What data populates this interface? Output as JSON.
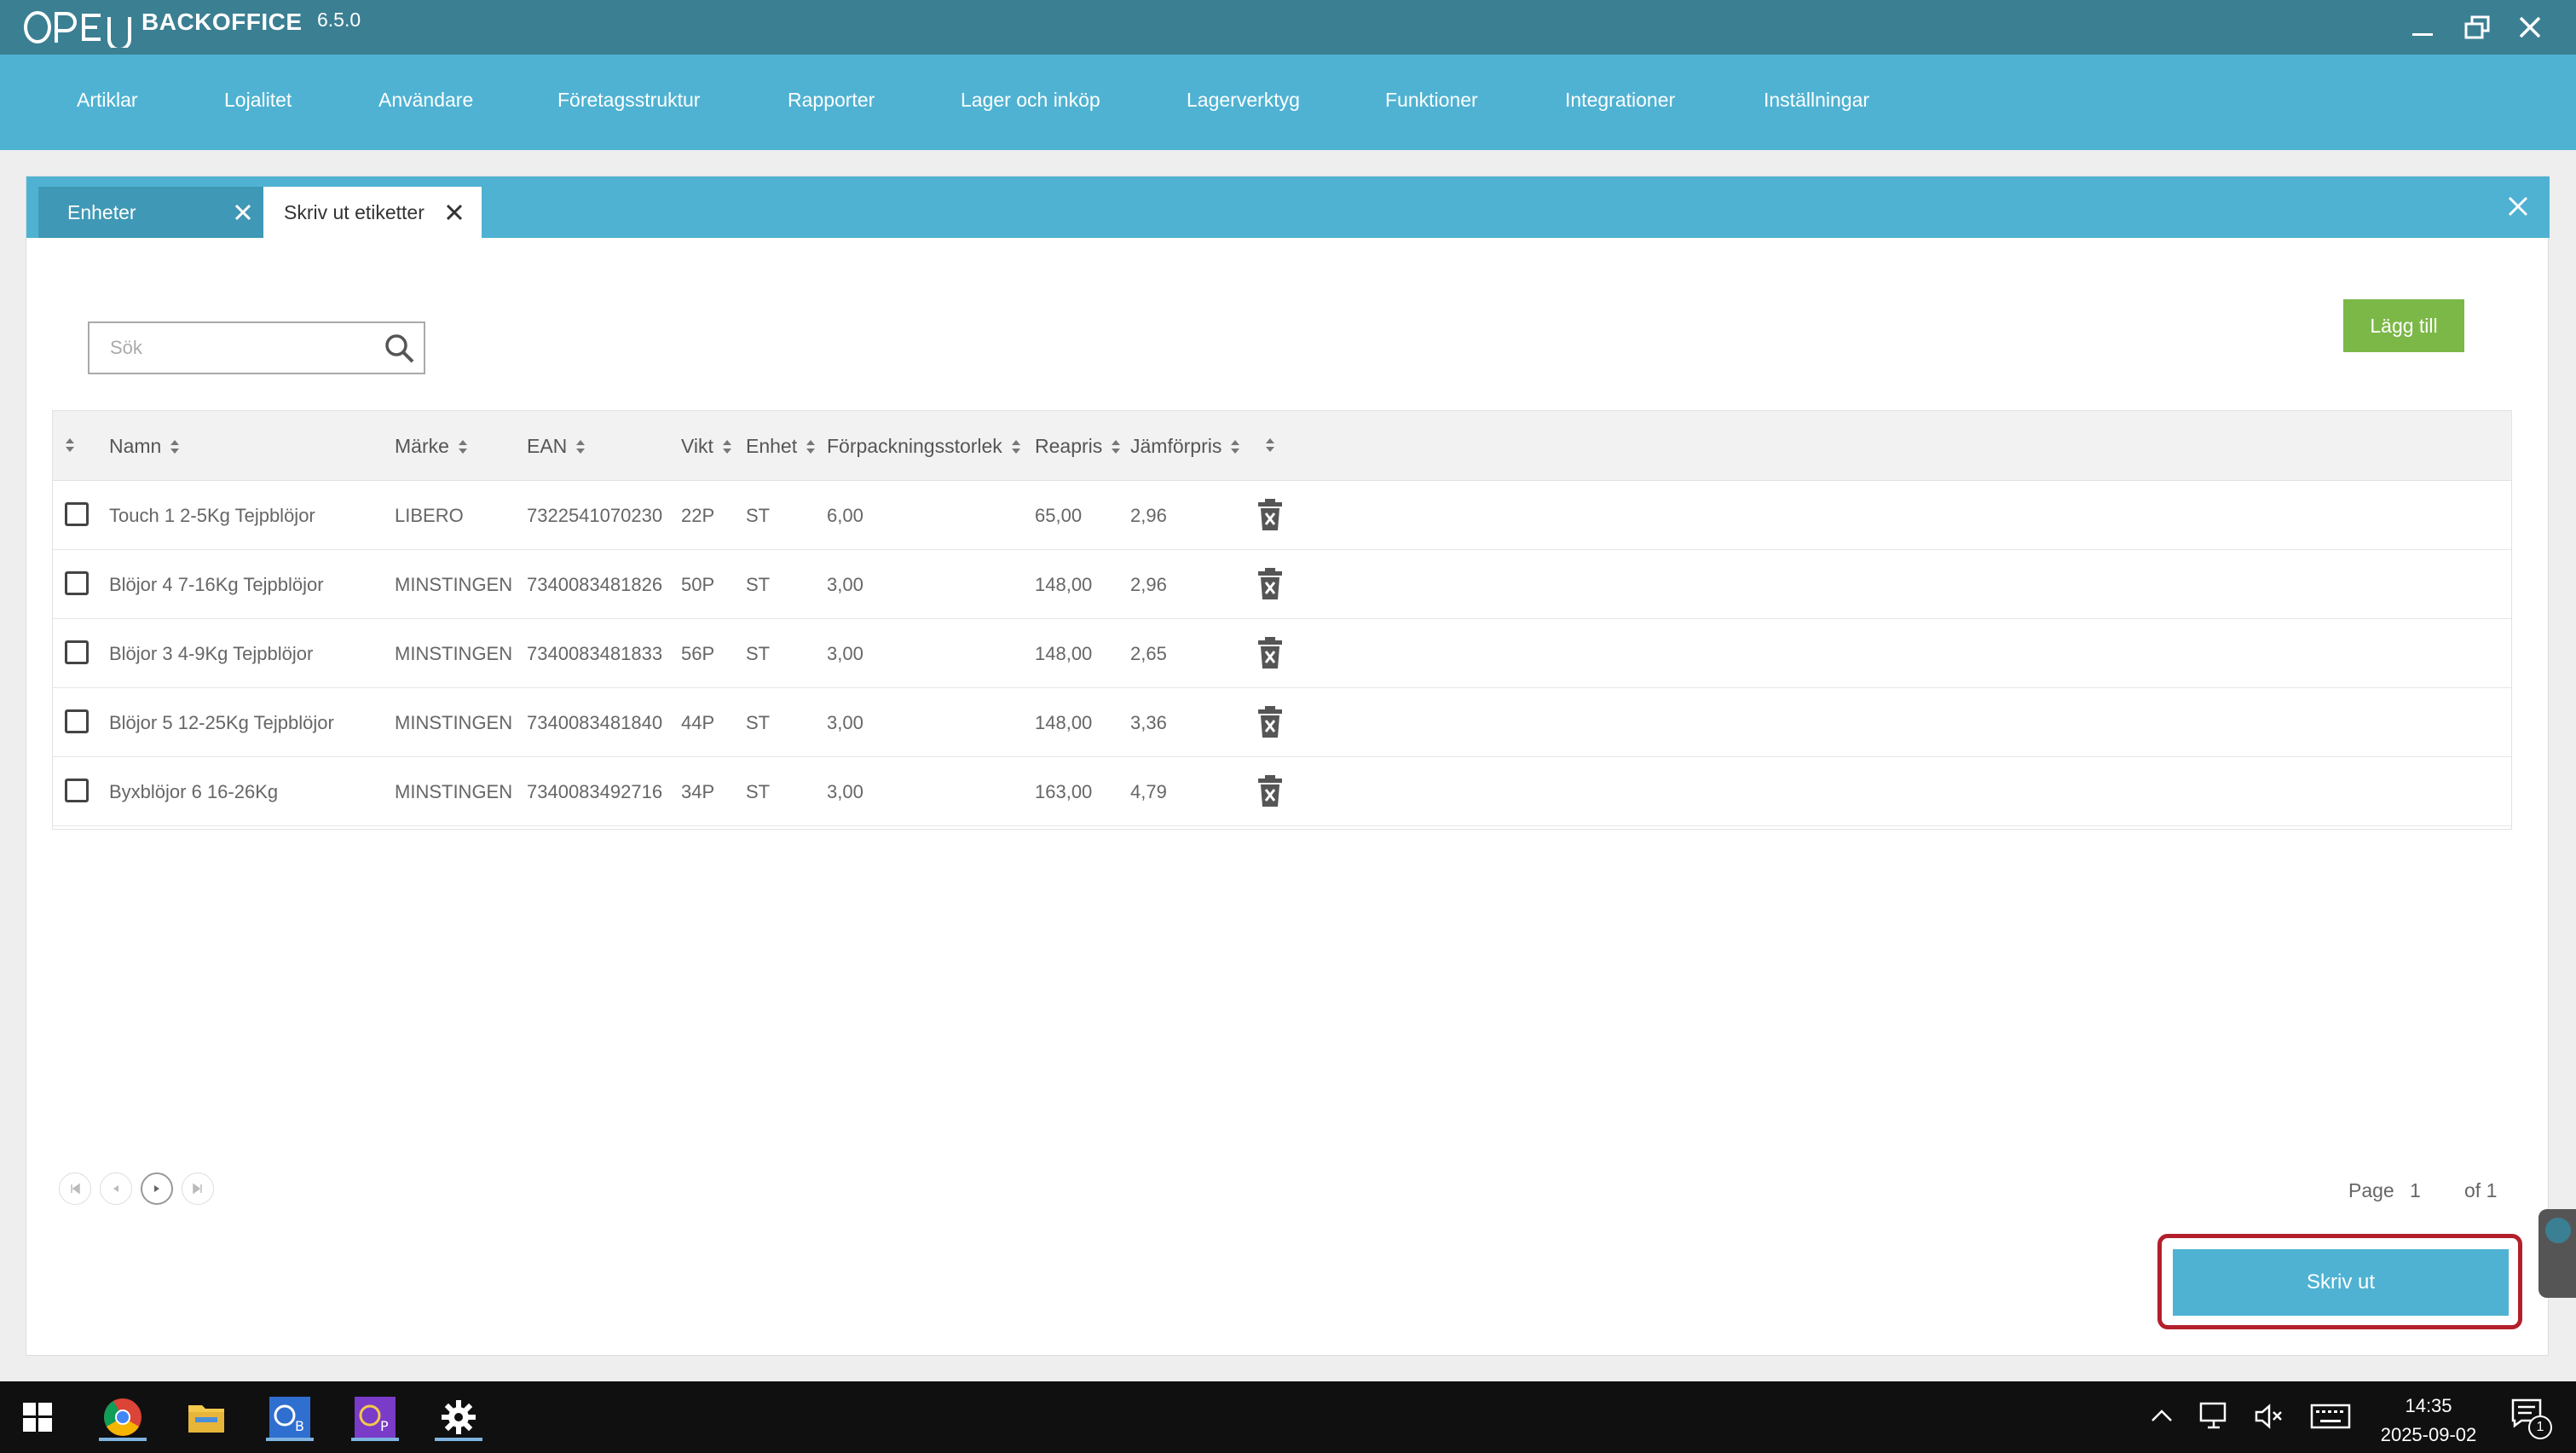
{
  "window": {
    "app_name": "BACKOFFICE",
    "version": "6.5.0",
    "logo_text": "OPEN",
    "colors": {
      "titlebar": "#3b7f93",
      "accent": "#4fb2d2",
      "add_button": "#7cb848",
      "highlight": "#b3202b"
    }
  },
  "menu": [
    {
      "label": "Artiklar"
    },
    {
      "label": "Lojalitet"
    },
    {
      "label": "Användare"
    },
    {
      "label": "Företagsstruktur"
    },
    {
      "label": "Rapporter"
    },
    {
      "label": "Lager och inköp"
    },
    {
      "label": "Lagerverktyg"
    },
    {
      "label": "Funktioner"
    },
    {
      "label": "Integrationer"
    },
    {
      "label": "Inställningar"
    }
  ],
  "tabs": [
    {
      "label": "Enheter",
      "active": false
    },
    {
      "label": "Skriv ut etiketter",
      "active": true
    }
  ],
  "search": {
    "placeholder": "Sök",
    "value": ""
  },
  "add_button": "Lägg till",
  "table": {
    "columns": [
      "Namn",
      "Märke",
      "EAN",
      "Vikt",
      "Enhet",
      "Förpackningsstorlek",
      "Reapris",
      "Jämförpris"
    ],
    "rows": [
      {
        "name": "Touch 1 2-5Kg Tejpblöjor",
        "brand": "LIBERO",
        "ean": "7322541070230",
        "weight": "22P",
        "unit": "ST",
        "pack": "6,00",
        "price": "65,00",
        "compare": "2,96"
      },
      {
        "name": "Blöjor 4 7-16Kg Tejpblöjor",
        "brand": "MINSTINGEN",
        "ean": "7340083481826",
        "weight": "50P",
        "unit": "ST",
        "pack": "3,00",
        "price": "148,00",
        "compare": "2,96"
      },
      {
        "name": "Blöjor 3 4-9Kg Tejpblöjor",
        "brand": "MINSTINGEN",
        "ean": "7340083481833",
        "weight": "56P",
        "unit": "ST",
        "pack": "3,00",
        "price": "148,00",
        "compare": "2,65"
      },
      {
        "name": "Blöjor 5 12-25Kg Tejpblöjor",
        "brand": "MINSTINGEN",
        "ean": "7340083481840",
        "weight": "44P",
        "unit": "ST",
        "pack": "3,00",
        "price": "148,00",
        "compare": "3,36"
      },
      {
        "name": "Byxblöjor 6 16-26Kg",
        "brand": "MINSTINGEN",
        "ean": "7340083492716",
        "weight": "34P",
        "unit": "ST",
        "pack": "3,00",
        "price": "163,00",
        "compare": "4,79"
      }
    ]
  },
  "pager": {
    "page_label": "Page",
    "page": "1",
    "of_label": "of 1"
  },
  "print_button": "Skriv ut",
  "taskbar": {
    "time": "14:35",
    "date": "2025-09-02",
    "notification_count": "1",
    "apps": [
      "windows-start-icon",
      "chrome-icon",
      "file-explorer-icon",
      "open-backoffice-icon",
      "open-pos-icon",
      "settings-gear-icon"
    ]
  }
}
